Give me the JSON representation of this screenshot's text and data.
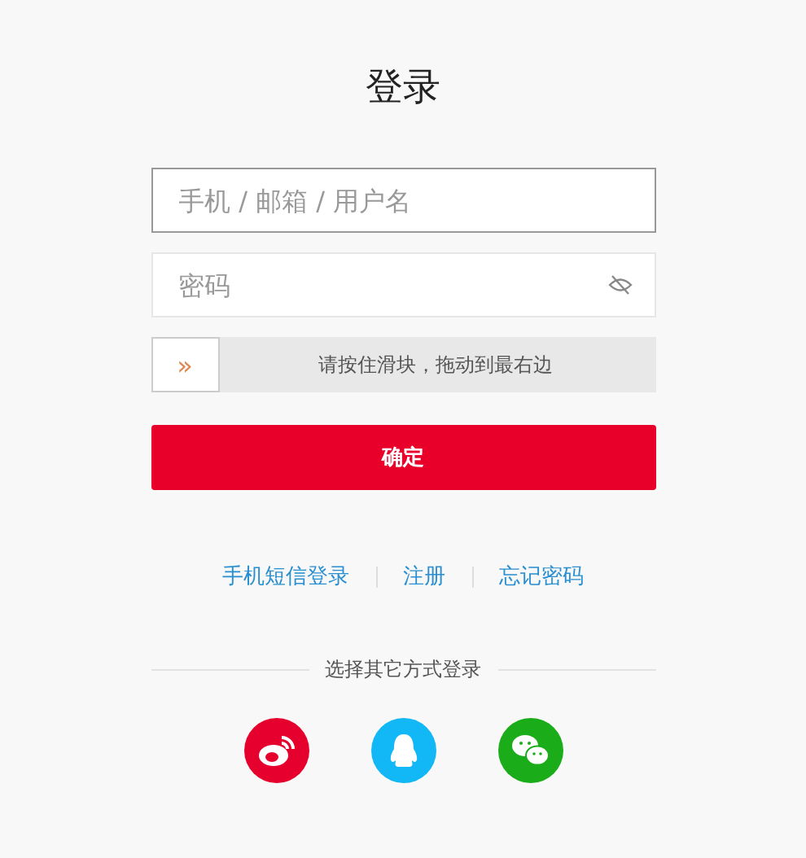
{
  "title": "登录",
  "username": {
    "placeholder": "手机 / 邮箱 / 用户名",
    "focused": true
  },
  "password": {
    "placeholder": "密码",
    "visible": false
  },
  "slider": {
    "hint": "请按住滑块，拖动到最右边",
    "handle": "»",
    "level": 0
  },
  "submit": "确定",
  "links": [
    "手机短信登录",
    "注册",
    "忘记密码"
  ],
  "other_login": "选择其它方式登录",
  "social": [
    {
      "kind": "weibo",
      "color": "#e6002d"
    },
    {
      "kind": "qq",
      "color": "#12b7f5"
    },
    {
      "kind": "wechat",
      "color": "#1aad19"
    }
  ]
}
